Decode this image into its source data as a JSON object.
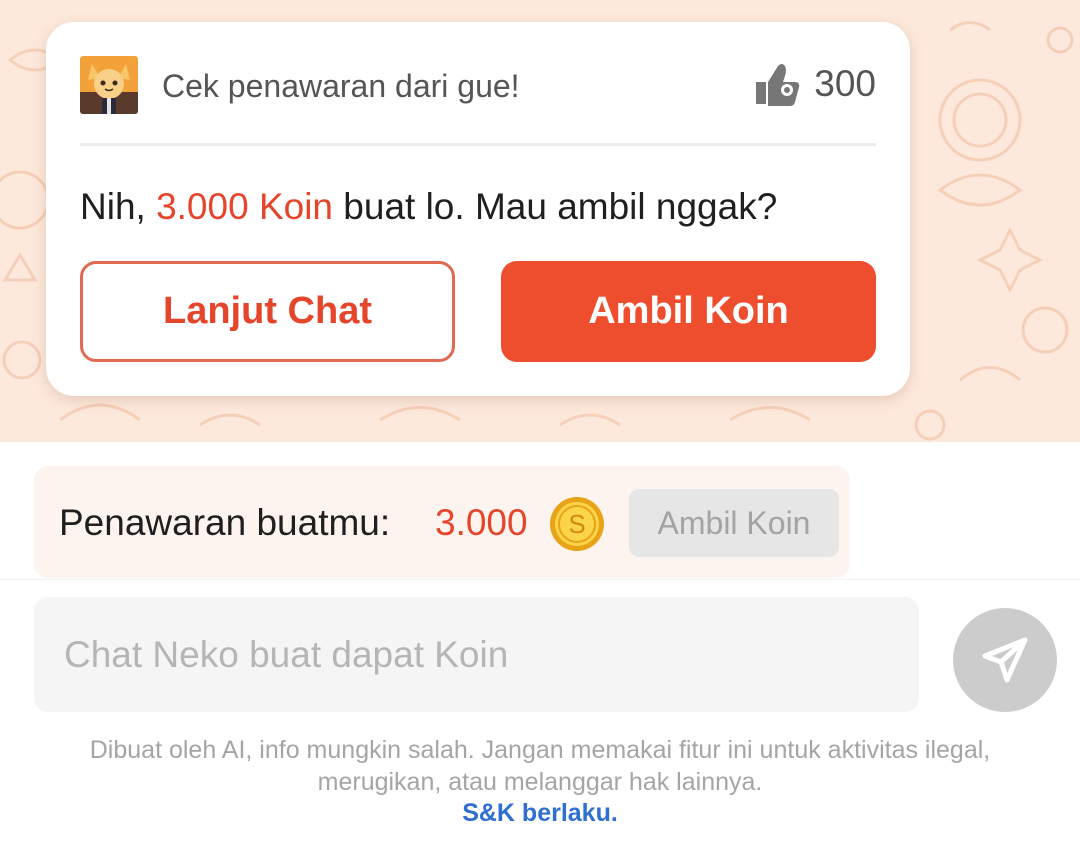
{
  "offer_card": {
    "header_text": "Cek penawaran dari gue!",
    "likes_count": "300",
    "message_prefix": "Nih, ",
    "message_amount": "3.000 Koin",
    "message_suffix": " buat lo. Mau ambil nggak?",
    "continue_button": "Lanjut Chat",
    "take_button": "Ambil Koin"
  },
  "offer_bar": {
    "label": "Penawaran buatmu:",
    "amount": "3.000",
    "coin_symbol": "S",
    "take_button": "Ambil Koin"
  },
  "chat_input": {
    "placeholder": "Chat Neko buat dapat Koin"
  },
  "disclaimer": {
    "line1": "Dibuat oleh AI, info mungkin salah. Jangan memakai fitur ini untuk aktivitas ilegal,",
    "line2": "merugikan, atau melanggar hak lainnya.",
    "link": "S&K berlaku."
  },
  "colors": {
    "accent": "#ee4e2d",
    "accent_text": "#e5452b",
    "chat_background": "#fde9dc",
    "link": "#2f6fcf"
  },
  "icons": {
    "likes": "thumbs-up-icon",
    "coin": "coin-icon",
    "send": "send-icon"
  }
}
